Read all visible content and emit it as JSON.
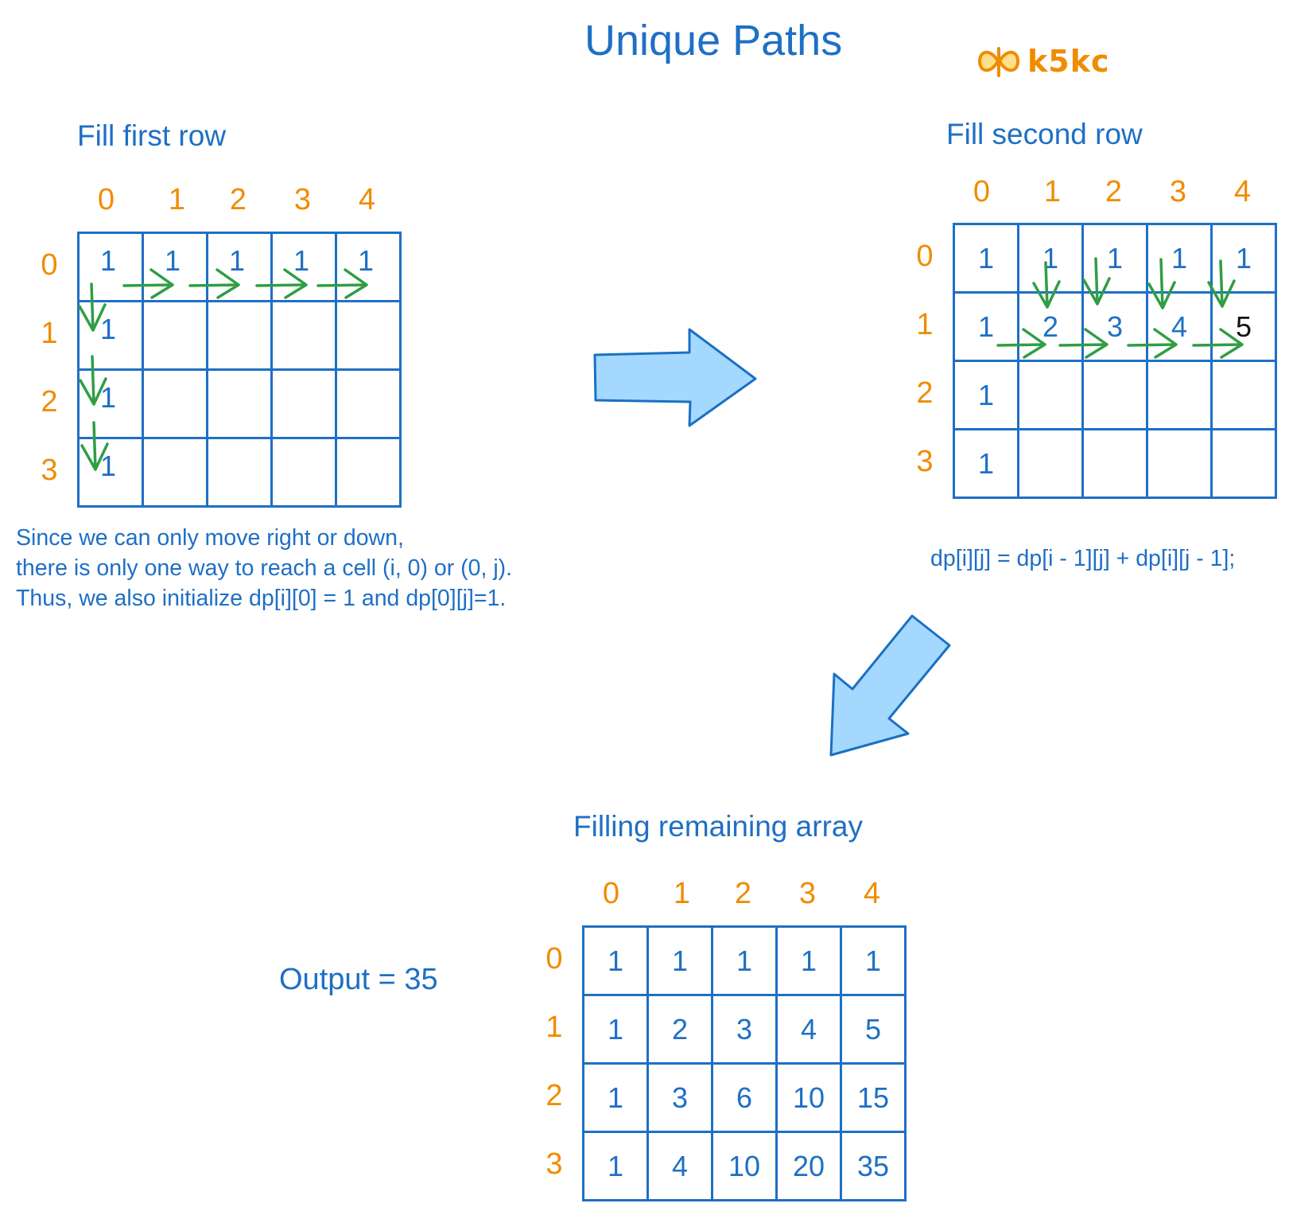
{
  "title": "Unique Paths",
  "brand": {
    "text": "k5kc",
    "icon": "butterfly-icon"
  },
  "colors": {
    "text_blue": "#1f6fc5",
    "index_orange": "#f08c00",
    "arrow_green": "#2f9e44",
    "block_arrow_fill": "#a5d8ff",
    "block_arrow_stroke": "#1971c2",
    "highlight_dark": "#111111"
  },
  "panels": {
    "first_row": {
      "heading": "Fill first row",
      "col_indices": [
        "0",
        "1",
        "2",
        "3",
        "4"
      ],
      "row_indices": [
        "0",
        "1",
        "2",
        "3"
      ],
      "cells": [
        [
          "1",
          "1",
          "1",
          "1",
          "1"
        ],
        [
          "1",
          "",
          "",
          "",
          ""
        ],
        [
          "1",
          "",
          "",
          "",
          ""
        ],
        [
          "1",
          "",
          "",
          "",
          ""
        ]
      ],
      "note_lines": [
        "Since we can only move right or down,",
        "there is only one way to reach a cell (i, 0) or (0, j).",
        "Thus, we also initialize dp[i][0] = 1 and dp[0][j]=1."
      ]
    },
    "second_row": {
      "heading": "Fill second row",
      "col_indices": [
        "0",
        "1",
        "2",
        "3",
        "4"
      ],
      "row_indices": [
        "0",
        "1",
        "2",
        "3"
      ],
      "cells": [
        [
          "1",
          "1",
          "1",
          "1",
          "1"
        ],
        [
          "1",
          "2",
          "3",
          "4",
          "5"
        ],
        [
          "1",
          "",
          "",
          "",
          ""
        ],
        [
          "1",
          "",
          "",
          "",
          ""
        ]
      ],
      "highlighted_cell": "5",
      "formula": "dp[i][j] = dp[i - 1][j] + dp[i][j - 1];"
    },
    "remaining": {
      "heading": "Filling remaining array",
      "col_indices": [
        "0",
        "1",
        "2",
        "3",
        "4"
      ],
      "row_indices": [
        "0",
        "1",
        "2",
        "3"
      ],
      "cells": [
        [
          "1",
          "1",
          "1",
          "1",
          "1"
        ],
        [
          "1",
          "2",
          "3",
          "4",
          "5"
        ],
        [
          "1",
          "3",
          "6",
          "10",
          "15"
        ],
        [
          "1",
          "4",
          "10",
          "20",
          "35"
        ]
      ],
      "output": "Output = 35"
    }
  }
}
